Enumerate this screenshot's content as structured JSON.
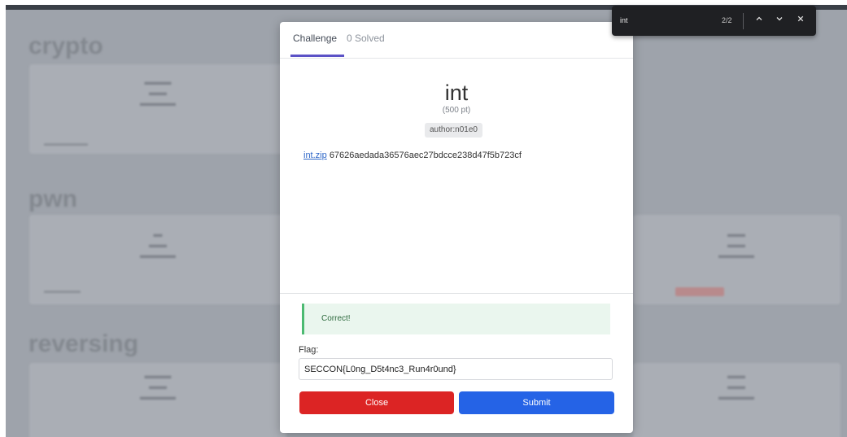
{
  "background": {
    "categories": [
      {
        "name": "crypto"
      },
      {
        "name": "pwn"
      },
      {
        "name": "reversing"
      }
    ]
  },
  "modal": {
    "tab_challenge": "Challenge",
    "tab_solved": "0 Solved",
    "title": "int",
    "points": "(500 pt)",
    "author": "author:n01e0",
    "file_link": "int.zip",
    "file_hash": "67626aedada36576aec27bdcce238d47f5b723cf",
    "alert": "Correct!",
    "flag_label": "Flag:",
    "flag_value": "SECCON{L0ng_D5t4nc3_Run4r0und}",
    "close_label": "Close",
    "submit_label": "Submit"
  },
  "findbar": {
    "query": "int",
    "count": "2/2"
  },
  "colors": {
    "accent": "#5b52c6",
    "close": "#dc2424",
    "submit": "#2563e6",
    "success": "#4cba72"
  }
}
